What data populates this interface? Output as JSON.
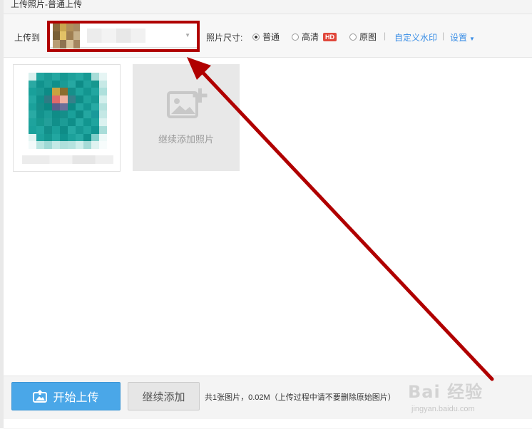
{
  "window": {
    "title": "上传照片-普通上传"
  },
  "toolbar": {
    "upload_to_label": "上传到",
    "size_label": "照片尺寸:",
    "size_options": [
      {
        "label": "普通",
        "checked": true
      },
      {
        "label": "高清",
        "checked": false,
        "badge": "HD"
      },
      {
        "label": "原图",
        "checked": false
      }
    ],
    "watermark_link": "自定义水印",
    "settings_link": "设置"
  },
  "content": {
    "add_tile_label": "继续添加照片"
  },
  "footer": {
    "start_button": "开始上传",
    "continue_button": "继续添加",
    "summary": "共1张图片，0.02M（上传过程中请不要删除原始图片）"
  },
  "watermark": {
    "main": "Bai 经验",
    "sub": "jingyan.baidu.com"
  },
  "colors": {
    "accent": "#4aa7e8",
    "link": "#3a8ee6",
    "highlight": "#b00000",
    "hd_badge": "#e0473b"
  }
}
